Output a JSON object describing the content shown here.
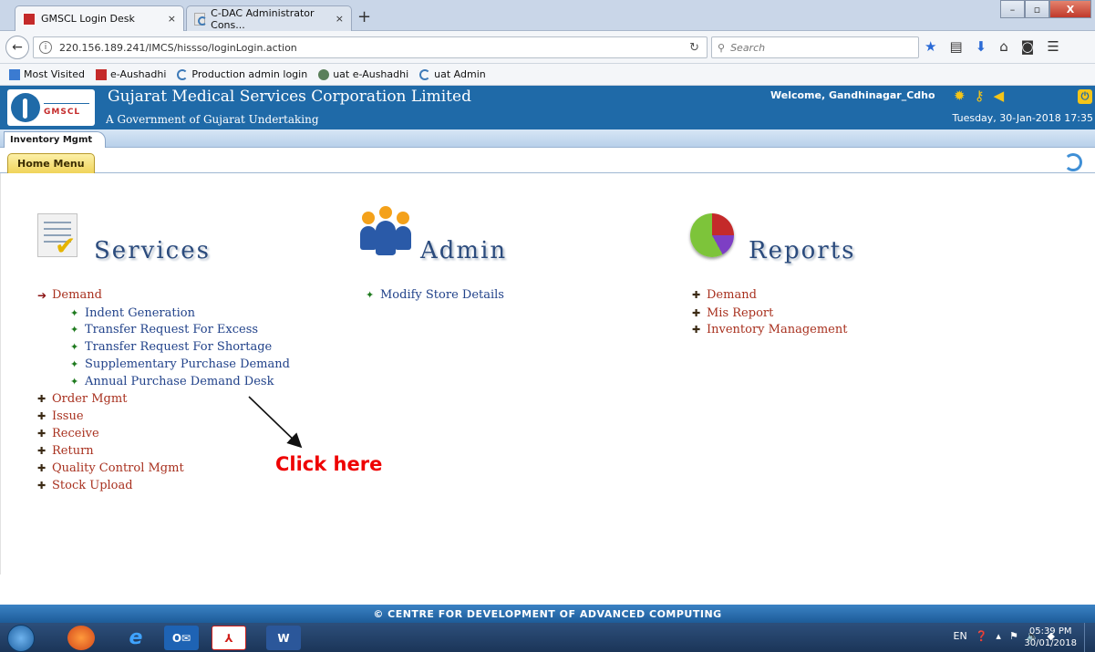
{
  "browser": {
    "tabs": [
      {
        "label": "GMSCL Login Desk",
        "active": true
      },
      {
        "label": "C-DAC Administrator Cons...",
        "active": false
      }
    ],
    "new_tab": "+",
    "url": "220.156.189.241/IMCS/hissso/loginLogin.action",
    "search_placeholder": "Search",
    "bookmarks": [
      "Most Visited",
      "e-Aushadhi",
      "Production admin login",
      "uat e-Aushadhi",
      "uat Admin"
    ],
    "window_controls": {
      "minimize": "–",
      "maximize": "▫",
      "close": "X"
    }
  },
  "header": {
    "org_name": "Gujarat Medical Services Corporation Limited",
    "org_sub": "A Government of Gujarat Undertaking",
    "logo_text": "GMSCL",
    "welcome": "Welcome, Gandhinagar_Cdho",
    "datetime": "Tuesday, 30-Jan-2018 17:35"
  },
  "module_tab": "Inventory Mgmt",
  "home_tab": "Home Menu",
  "sections": {
    "services": {
      "title": "Services",
      "items": [
        {
          "label": "Demand",
          "level": 0,
          "expanded": true
        },
        {
          "label": "Indent Generation",
          "level": 1
        },
        {
          "label": "Transfer Request For Excess",
          "level": 1
        },
        {
          "label": "Transfer Request For Shortage",
          "level": 1
        },
        {
          "label": "Supplementary Purchase Demand",
          "level": 1
        },
        {
          "label": "Annual Purchase Demand Desk",
          "level": 1
        },
        {
          "label": "Order Mgmt",
          "level": 0
        },
        {
          "label": "Issue",
          "level": 0
        },
        {
          "label": "Receive",
          "level": 0
        },
        {
          "label": "Return",
          "level": 0
        },
        {
          "label": "Quality Control Mgmt",
          "level": 0
        },
        {
          "label": "Stock Upload",
          "level": 0
        }
      ]
    },
    "admin": {
      "title": "Admin",
      "items": [
        {
          "label": "Modify Store Details",
          "level": 1
        }
      ]
    },
    "reports": {
      "title": "Reports",
      "items": [
        {
          "label": "Demand",
          "level": 0
        },
        {
          "label": "Mis Report",
          "level": 0
        },
        {
          "label": "Inventory Management",
          "level": 0
        }
      ]
    }
  },
  "annotation": "Click here",
  "footer": "© CENTRE FOR DEVELOPMENT OF ADVANCED COMPUTING",
  "taskbar": {
    "lang": "EN",
    "time": "05:39 PM",
    "date": "30/01/2018"
  },
  "colors": {
    "header_blue": "#1f6aa8",
    "menu_red": "#a8301e",
    "submenu_blue": "#21428a",
    "annotation_red": "#ee0000"
  }
}
